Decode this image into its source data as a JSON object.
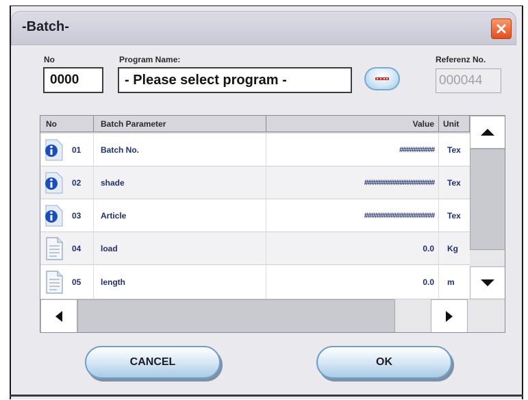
{
  "dialog": {
    "title": "-Batch-"
  },
  "header_fields": {
    "no_label": "No",
    "no_value": "0000",
    "program_label": "Program Name:",
    "program_value": "- Please select program -",
    "browse_icon": "ellipsis-icon",
    "referenz_label": "Referenz No.",
    "referenz_value": "000044"
  },
  "grid": {
    "columns": [
      "No",
      "Batch Parameter",
      "Value",
      "Unit"
    ],
    "rows": [
      {
        "icon": "info-icon",
        "no": "01",
        "parameter": "Batch No.",
        "value": "##########",
        "unit": "Tex"
      },
      {
        "icon": "info-icon",
        "no": "02",
        "parameter": "shade",
        "value": "####################",
        "unit": "Tex"
      },
      {
        "icon": "info-icon",
        "no": "03",
        "parameter": "Article",
        "value": "####################",
        "unit": "Tex"
      },
      {
        "icon": "document-icon",
        "no": "04",
        "parameter": "load",
        "value": "0.0",
        "unit": "Kg"
      },
      {
        "icon": "document-icon",
        "no": "05",
        "parameter": "length",
        "value": "0.0",
        "unit": "m"
      }
    ]
  },
  "buttons": {
    "cancel": "CANCEL",
    "ok": "OK"
  },
  "colors": {
    "close_button": "#e34d20",
    "button_border": "#6f9dc4",
    "info_icon": "#1b4fb8"
  }
}
